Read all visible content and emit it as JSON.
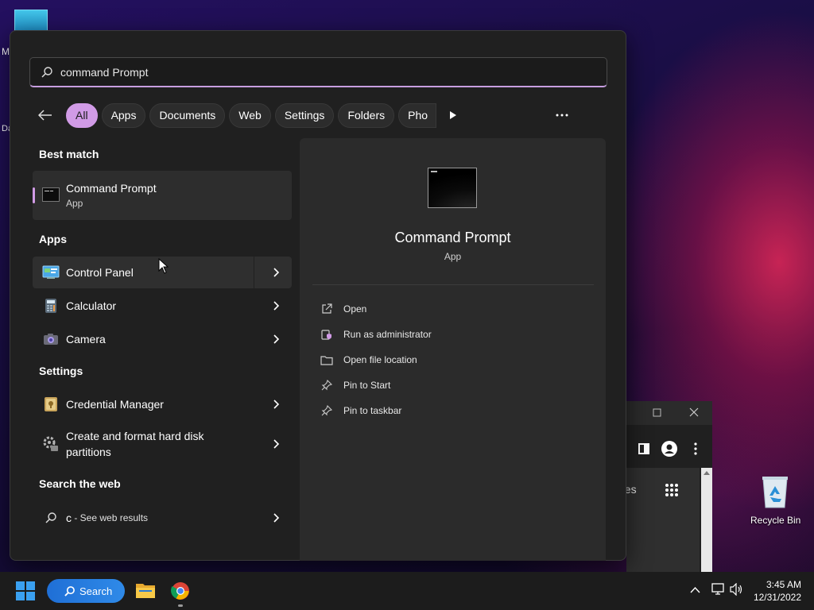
{
  "desktop": {
    "left_letters": [
      "M",
      "Da"
    ],
    "recycle_bin_label": "Recycle Bin",
    "background_browser": {
      "partial_text": "ges"
    }
  },
  "search": {
    "query": "command Prompt",
    "icon": "search-icon"
  },
  "filters": {
    "back_icon": "back-arrow-icon",
    "chips": [
      "All",
      "Apps",
      "Documents",
      "Web",
      "Settings",
      "Folders",
      "Pho"
    ],
    "active": "All",
    "more_icon": "more-icon",
    "scroll_icon": "play-icon"
  },
  "results": {
    "best_match_header": "Best match",
    "best_match": {
      "name": "Command Prompt",
      "type": "App"
    },
    "apps_header": "Apps",
    "apps": [
      {
        "label": "Control Panel",
        "icon": "control-panel-icon"
      },
      {
        "label": "Calculator",
        "icon": "calculator-icon"
      },
      {
        "label": "Camera",
        "icon": "camera-icon"
      }
    ],
    "settings_header": "Settings",
    "settings": [
      {
        "label": "Credential Manager",
        "icon": "credential-manager-icon"
      },
      {
        "label_line1": "Create and format hard disk",
        "label_line2": "partitions",
        "icon": "disk-partition-icon"
      }
    ],
    "web_header": "Search the web",
    "web": {
      "query": "c",
      "suffix": " - See web results"
    }
  },
  "detail": {
    "title": "Command Prompt",
    "subtitle": "App",
    "actions": [
      {
        "label": "Open",
        "icon": "open-icon"
      },
      {
        "label": "Run as administrator",
        "icon": "shield-icon"
      },
      {
        "label": "Open file location",
        "icon": "folder-icon"
      },
      {
        "label": "Pin to Start",
        "icon": "pin-icon"
      },
      {
        "label": "Pin to taskbar",
        "icon": "pin-icon"
      }
    ]
  },
  "taskbar": {
    "search_label": "Search",
    "time": "3:45 AM",
    "date": "12/31/2022"
  },
  "colors": {
    "accent": "#d19be6",
    "taskbar_search": "#2f8ae8"
  }
}
